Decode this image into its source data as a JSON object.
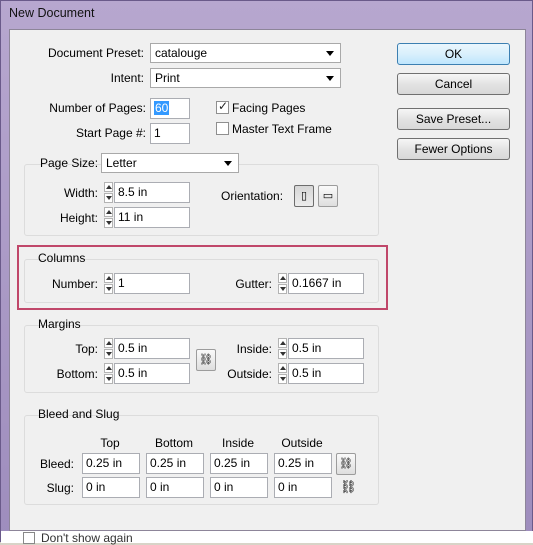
{
  "window": {
    "title": "New Document"
  },
  "document_preset": {
    "label": "Document Preset:",
    "value": "catalouge"
  },
  "intent": {
    "label": "Intent:",
    "value": "Print"
  },
  "pages": {
    "number_label": "Number of Pages:",
    "number_value": "60",
    "start_label": "Start Page #:",
    "start_value": "1",
    "facing_pages": {
      "label": "Facing Pages",
      "checked": true
    },
    "master_text_frame": {
      "label": "Master Text Frame",
      "checked": false
    }
  },
  "buttons": {
    "ok": "OK",
    "cancel": "Cancel",
    "save_preset": "Save Preset...",
    "fewer_options": "Fewer Options"
  },
  "page_size": {
    "label": "Page Size:",
    "value": "Letter",
    "width_label": "Width:",
    "width_value": "8.5 in",
    "height_label": "Height:",
    "height_value": "11 in",
    "orientation_label": "Orientation:"
  },
  "columns": {
    "title": "Columns",
    "number_label": "Number:",
    "number_value": "1",
    "gutter_label": "Gutter:",
    "gutter_value": "0.1667 in"
  },
  "margins": {
    "title": "Margins",
    "top_label": "Top:",
    "top_value": "0.5 in",
    "bottom_label": "Bottom:",
    "bottom_value": "0.5 in",
    "inside_label": "Inside:",
    "inside_value": "0.5 in",
    "outside_label": "Outside:",
    "outside_value": "0.5 in"
  },
  "bleed_slug": {
    "title": "Bleed and Slug",
    "headers": [
      "Top",
      "Bottom",
      "Inside",
      "Outside"
    ],
    "bleed_label": "Bleed:",
    "bleed_values": [
      "0.25 in",
      "0.25 in",
      "0.25 in",
      "0.25 in"
    ],
    "slug_label": "Slug:",
    "slug_values": [
      "0 in",
      "0 in",
      "0 in",
      "0 in"
    ]
  },
  "footer": {
    "dont_show_again": "Don't show again"
  },
  "colors": {
    "highlight": "#c0476a",
    "selection": "#3399ff"
  }
}
